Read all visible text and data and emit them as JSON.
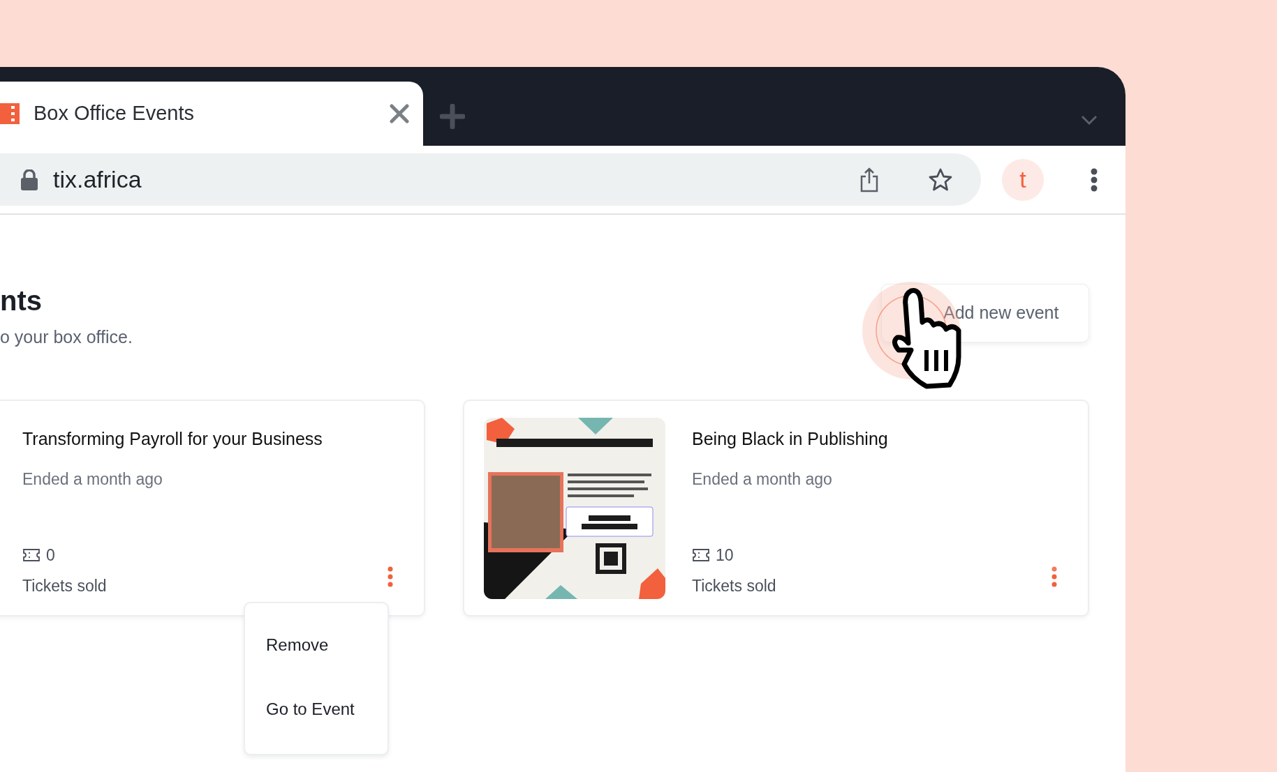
{
  "browser": {
    "tab": {
      "title": "Box Office Events",
      "selected": true
    },
    "address": "tix.africa",
    "profile_initial": "t"
  },
  "page": {
    "heading": "nts",
    "subtitle": "o your box office.",
    "add_button": "Add new event"
  },
  "events": [
    {
      "title": "Transforming Payroll for your Business",
      "status": "Ended a month ago",
      "tickets": "0",
      "tickets_label": "Tickets sold",
      "poster": false,
      "menu_open": true
    },
    {
      "title": "Being Black in Publishing",
      "status": "Ended a month ago",
      "tickets": "10",
      "tickets_label": "Tickets sold",
      "poster": true,
      "menu_open": false
    }
  ],
  "context_menu": [
    "Remove",
    "Go to Event"
  ]
}
